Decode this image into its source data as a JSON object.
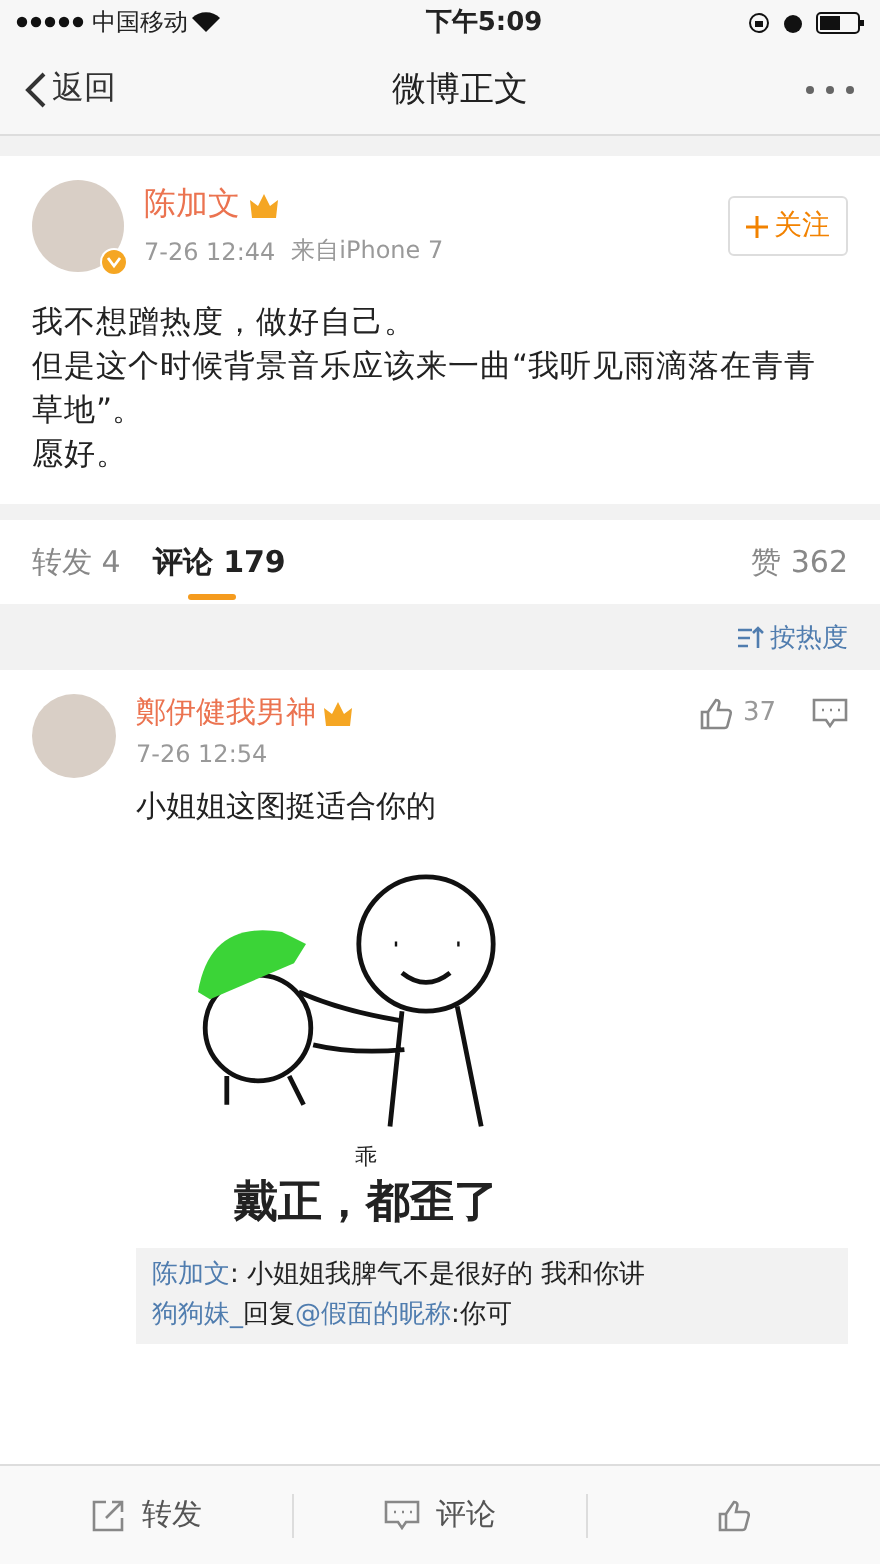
{
  "status_bar": {
    "carrier": "中国移动",
    "time": "下午5:09"
  },
  "nav": {
    "back": "返回",
    "title": "微博正文"
  },
  "post": {
    "author": "陈加文",
    "time": "7-26 12:44",
    "source": "来自iPhone 7",
    "follow": "关注",
    "verified": true,
    "paragraphs": [
      "我不想蹭热度，做好自己。",
      "但是这个时候背景音乐应该来一曲“我听见雨滴落在青青草地”。",
      "愿好。"
    ]
  },
  "tabs": [
    {
      "label": "转发",
      "count": "4",
      "selected": false
    },
    {
      "label": "评论",
      "count": "179",
      "selected": true
    }
  ],
  "likes": {
    "label": "赞",
    "count": "362"
  },
  "sort": "按热度",
  "comments": [
    {
      "author": "鄭伊健我男神",
      "time": "7-26 12:54",
      "likes": "37",
      "text": "小姐姐这图挺适合你的",
      "image": {
        "small_label": "乖",
        "caption": "戴正，都歪了"
      },
      "replies": [
        [
          {
            "text": "陈加文",
            "link": true
          },
          {
            "text": ": 小姐姐我脾气不是很好的 我和你讲",
            "link": false
          }
        ],
        [
          {
            "text": "狗狗妹_",
            "link": true
          },
          {
            "text": "回复",
            "link": false
          },
          {
            "text": "@假面的昵称",
            "link": true
          },
          {
            "text": ":你可",
            "link": false
          }
        ]
      ]
    }
  ],
  "bottom_bar": [
    {
      "kind": "repost",
      "label": "转发"
    },
    {
      "kind": "comment",
      "label": "评论"
    },
    {
      "kind": "like"
    }
  ]
}
